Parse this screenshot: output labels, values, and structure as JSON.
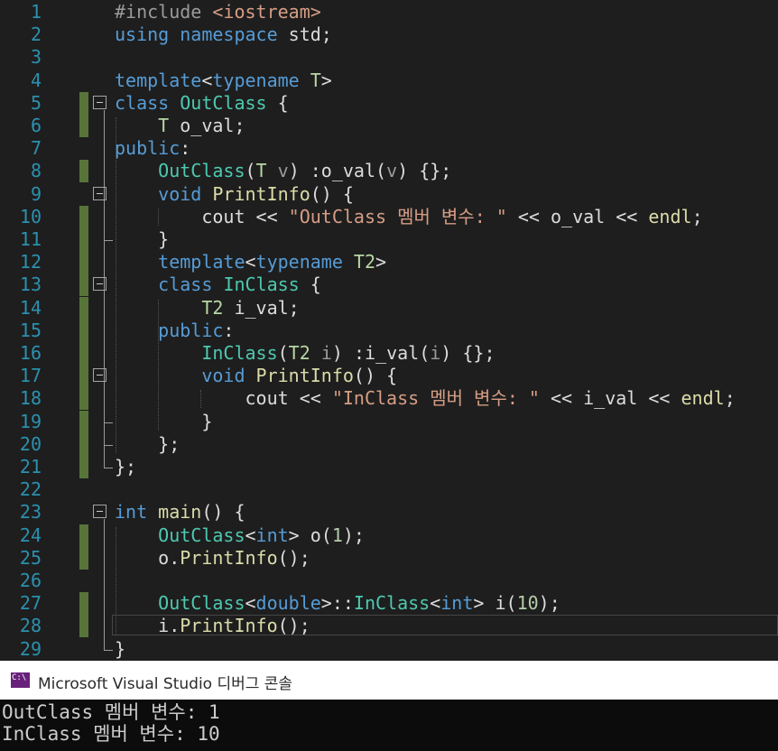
{
  "editor": {
    "line_numbers": [
      "1",
      "2",
      "3",
      "4",
      "5",
      "6",
      "7",
      "8",
      "9",
      "10",
      "11",
      "12",
      "13",
      "14",
      "15",
      "16",
      "17",
      "18",
      "19",
      "20",
      "21",
      "22",
      "23",
      "24",
      "25",
      "26",
      "27",
      "28",
      "29"
    ],
    "lines": [
      [
        [
          "#include ",
          "pp"
        ],
        [
          "<iostream>",
          "inc"
        ]
      ],
      [
        [
          "using",
          "kw"
        ],
        [
          " ",
          ""
        ],
        [
          "namespace",
          "kw"
        ],
        [
          " std;",
          ""
        ]
      ],
      [],
      [
        [
          "template",
          "kw"
        ],
        [
          "<",
          ""
        ],
        [
          "typename",
          "kw"
        ],
        [
          " ",
          ""
        ],
        [
          "T",
          "tp"
        ],
        [
          ">",
          ""
        ]
      ],
      [
        [
          "class",
          "kw"
        ],
        [
          " ",
          ""
        ],
        [
          "OutClass",
          "ty"
        ],
        [
          " {",
          ""
        ]
      ],
      [
        [
          "    ",
          ""
        ],
        [
          "T",
          "tp"
        ],
        [
          " o_val;",
          "mb"
        ]
      ],
      [
        [
          "public",
          "kw"
        ],
        [
          ":",
          ""
        ]
      ],
      [
        [
          "    ",
          ""
        ],
        [
          "OutClass",
          "ty"
        ],
        [
          "(",
          ""
        ],
        [
          "T",
          "tp"
        ],
        [
          " ",
          ""
        ],
        [
          "v",
          "pm"
        ],
        [
          ") :o_val(",
          ""
        ],
        [
          "v",
          "pm"
        ],
        [
          ") {};",
          ""
        ]
      ],
      [
        [
          "    ",
          ""
        ],
        [
          "void",
          "kw"
        ],
        [
          " ",
          ""
        ],
        [
          "PrintInfo",
          "fn"
        ],
        [
          "() {",
          ""
        ]
      ],
      [
        [
          "        cout << ",
          ""
        ],
        [
          "\"OutClass 멤버 변수: \"",
          "str"
        ],
        [
          " << o_val << ",
          ""
        ],
        [
          "endl",
          "fn"
        ],
        [
          ";",
          ""
        ]
      ],
      [
        [
          "    }",
          ""
        ]
      ],
      [
        [
          "    ",
          ""
        ],
        [
          "template",
          "kw"
        ],
        [
          "<",
          ""
        ],
        [
          "typename",
          "kw"
        ],
        [
          " ",
          ""
        ],
        [
          "T2",
          "tp"
        ],
        [
          ">",
          ""
        ]
      ],
      [
        [
          "    ",
          ""
        ],
        [
          "class",
          "kw"
        ],
        [
          " ",
          ""
        ],
        [
          "InClass",
          "ty"
        ],
        [
          " {",
          ""
        ]
      ],
      [
        [
          "        ",
          ""
        ],
        [
          "T2",
          "tp"
        ],
        [
          " i_val;",
          ""
        ]
      ],
      [
        [
          "    ",
          ""
        ],
        [
          "public",
          "kw"
        ],
        [
          ":",
          ""
        ]
      ],
      [
        [
          "        ",
          ""
        ],
        [
          "InClass",
          "ty"
        ],
        [
          "(",
          ""
        ],
        [
          "T2",
          "tp"
        ],
        [
          " ",
          ""
        ],
        [
          "i",
          "pm"
        ],
        [
          ") :i_val(",
          ""
        ],
        [
          "i",
          "pm"
        ],
        [
          ") {};",
          ""
        ]
      ],
      [
        [
          "        ",
          ""
        ],
        [
          "void",
          "kw"
        ],
        [
          " ",
          ""
        ],
        [
          "PrintInfo",
          "fn"
        ],
        [
          "() {",
          ""
        ]
      ],
      [
        [
          "            cout << ",
          ""
        ],
        [
          "\"InClass 멤버 변수: \"",
          "str"
        ],
        [
          " << i_val << ",
          ""
        ],
        [
          "endl",
          "fn"
        ],
        [
          ";",
          ""
        ]
      ],
      [
        [
          "        }",
          ""
        ]
      ],
      [
        [
          "    };",
          ""
        ]
      ],
      [
        [
          "};",
          ""
        ]
      ],
      [],
      [
        [
          "int",
          "kw"
        ],
        [
          " ",
          ""
        ],
        [
          "main",
          "fn"
        ],
        [
          "() {",
          ""
        ]
      ],
      [
        [
          "    ",
          ""
        ],
        [
          "OutClass",
          "ty"
        ],
        [
          "<",
          ""
        ],
        [
          "int",
          "kw"
        ],
        [
          "> o(",
          ""
        ],
        [
          "1",
          "nm"
        ],
        [
          ");",
          ""
        ]
      ],
      [
        [
          "    o.",
          ""
        ],
        [
          "PrintInfo",
          "fn"
        ],
        [
          "();",
          ""
        ]
      ],
      [],
      [
        [
          "    ",
          ""
        ],
        [
          "OutClass",
          "ty"
        ],
        [
          "<",
          ""
        ],
        [
          "double",
          "kw"
        ],
        [
          ">::",
          ""
        ],
        [
          "InClass",
          "ty"
        ],
        [
          "<",
          ""
        ],
        [
          "int",
          "kw"
        ],
        [
          "> i(",
          ""
        ],
        [
          "10",
          "nm"
        ],
        [
          ");",
          ""
        ]
      ],
      [
        [
          "    i.",
          ""
        ],
        [
          "PrintInfo",
          "fn"
        ],
        [
          "();",
          ""
        ]
      ],
      [
        [
          "}",
          ""
        ]
      ]
    ]
  },
  "console": {
    "icon": "console-app-icon",
    "title": "Microsoft Visual Studio 디버그 콘솔",
    "output": [
      "OutClass 멤버 변수: 1",
      "InClass 멤버 변수: 10"
    ]
  },
  "colors": {
    "background": "#1e1e1e",
    "keyword": "#569cd6",
    "type": "#4ec9b0",
    "string": "#d69d85",
    "function": "#dcdcaa",
    "number": "#b5cea8",
    "line_number": "#2b91af",
    "change_marker": "#57743a"
  }
}
